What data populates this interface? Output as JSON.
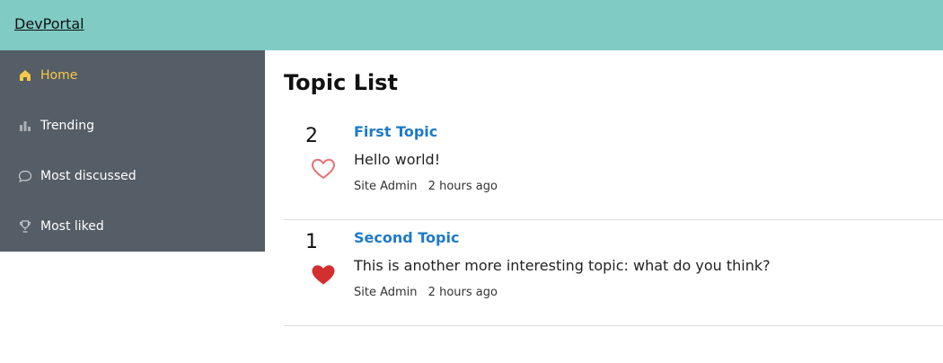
{
  "header": {
    "brand": "DevPortal"
  },
  "sidebar": {
    "items": [
      {
        "label": "Home",
        "icon": "home-icon",
        "active": true
      },
      {
        "label": "Trending",
        "icon": "bar-chart-icon",
        "active": false
      },
      {
        "label": "Most discussed",
        "icon": "chat-bubble-icon",
        "active": false
      },
      {
        "label": "Most liked",
        "icon": "trophy-icon",
        "active": false
      }
    ]
  },
  "main": {
    "title": "Topic List",
    "topics": [
      {
        "votes": "2",
        "liked": false,
        "title": "First Topic",
        "body": "Hello world!",
        "author": "Site Admin",
        "time": "2 hours ago"
      },
      {
        "votes": "1",
        "liked": true,
        "title": "Second Topic",
        "body": "This is another more interesting topic: what do you think?",
        "author": "Site Admin",
        "time": "2 hours ago"
      }
    ]
  },
  "colors": {
    "header_bg": "#80cbc4",
    "sidebar_bg": "#555d66",
    "active_nav": "#f7c948",
    "link": "#1e7ac7",
    "heart_outline": "#e57373",
    "heart_filled": "#d32f2f"
  }
}
